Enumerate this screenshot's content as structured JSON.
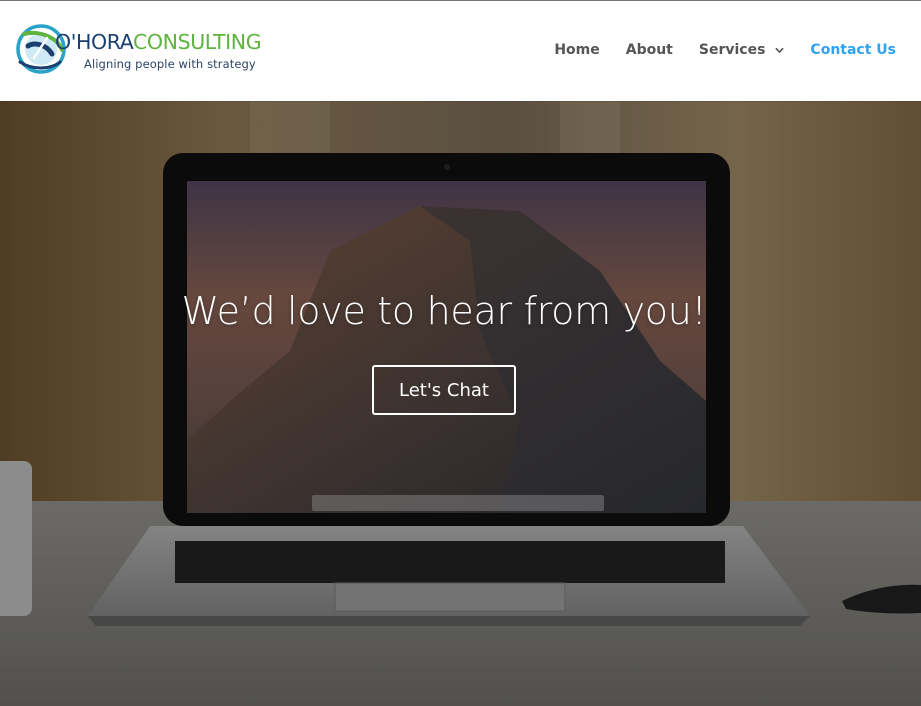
{
  "brand": {
    "name_part1": "O'HORA",
    "name_part2": "CONSULTING",
    "tagline": "Aligning people with strategy",
    "colors": {
      "navy": "#1b3f6e",
      "green": "#5fb33f",
      "teal": "#2aa3c9"
    }
  },
  "nav": {
    "items": [
      {
        "label": "Home",
        "active": false
      },
      {
        "label": "About",
        "active": false
      },
      {
        "label": "Services",
        "active": false,
        "has_dropdown": true
      },
      {
        "label": "Contact Us",
        "active": true
      }
    ],
    "active_color": "#2ea3f2",
    "dropdown_icon": "chevron-down-icon"
  },
  "hero": {
    "title": "We’d love to hear from you!",
    "cta_label": "Let's Chat",
    "background": "laptop-on-desk-photo"
  }
}
